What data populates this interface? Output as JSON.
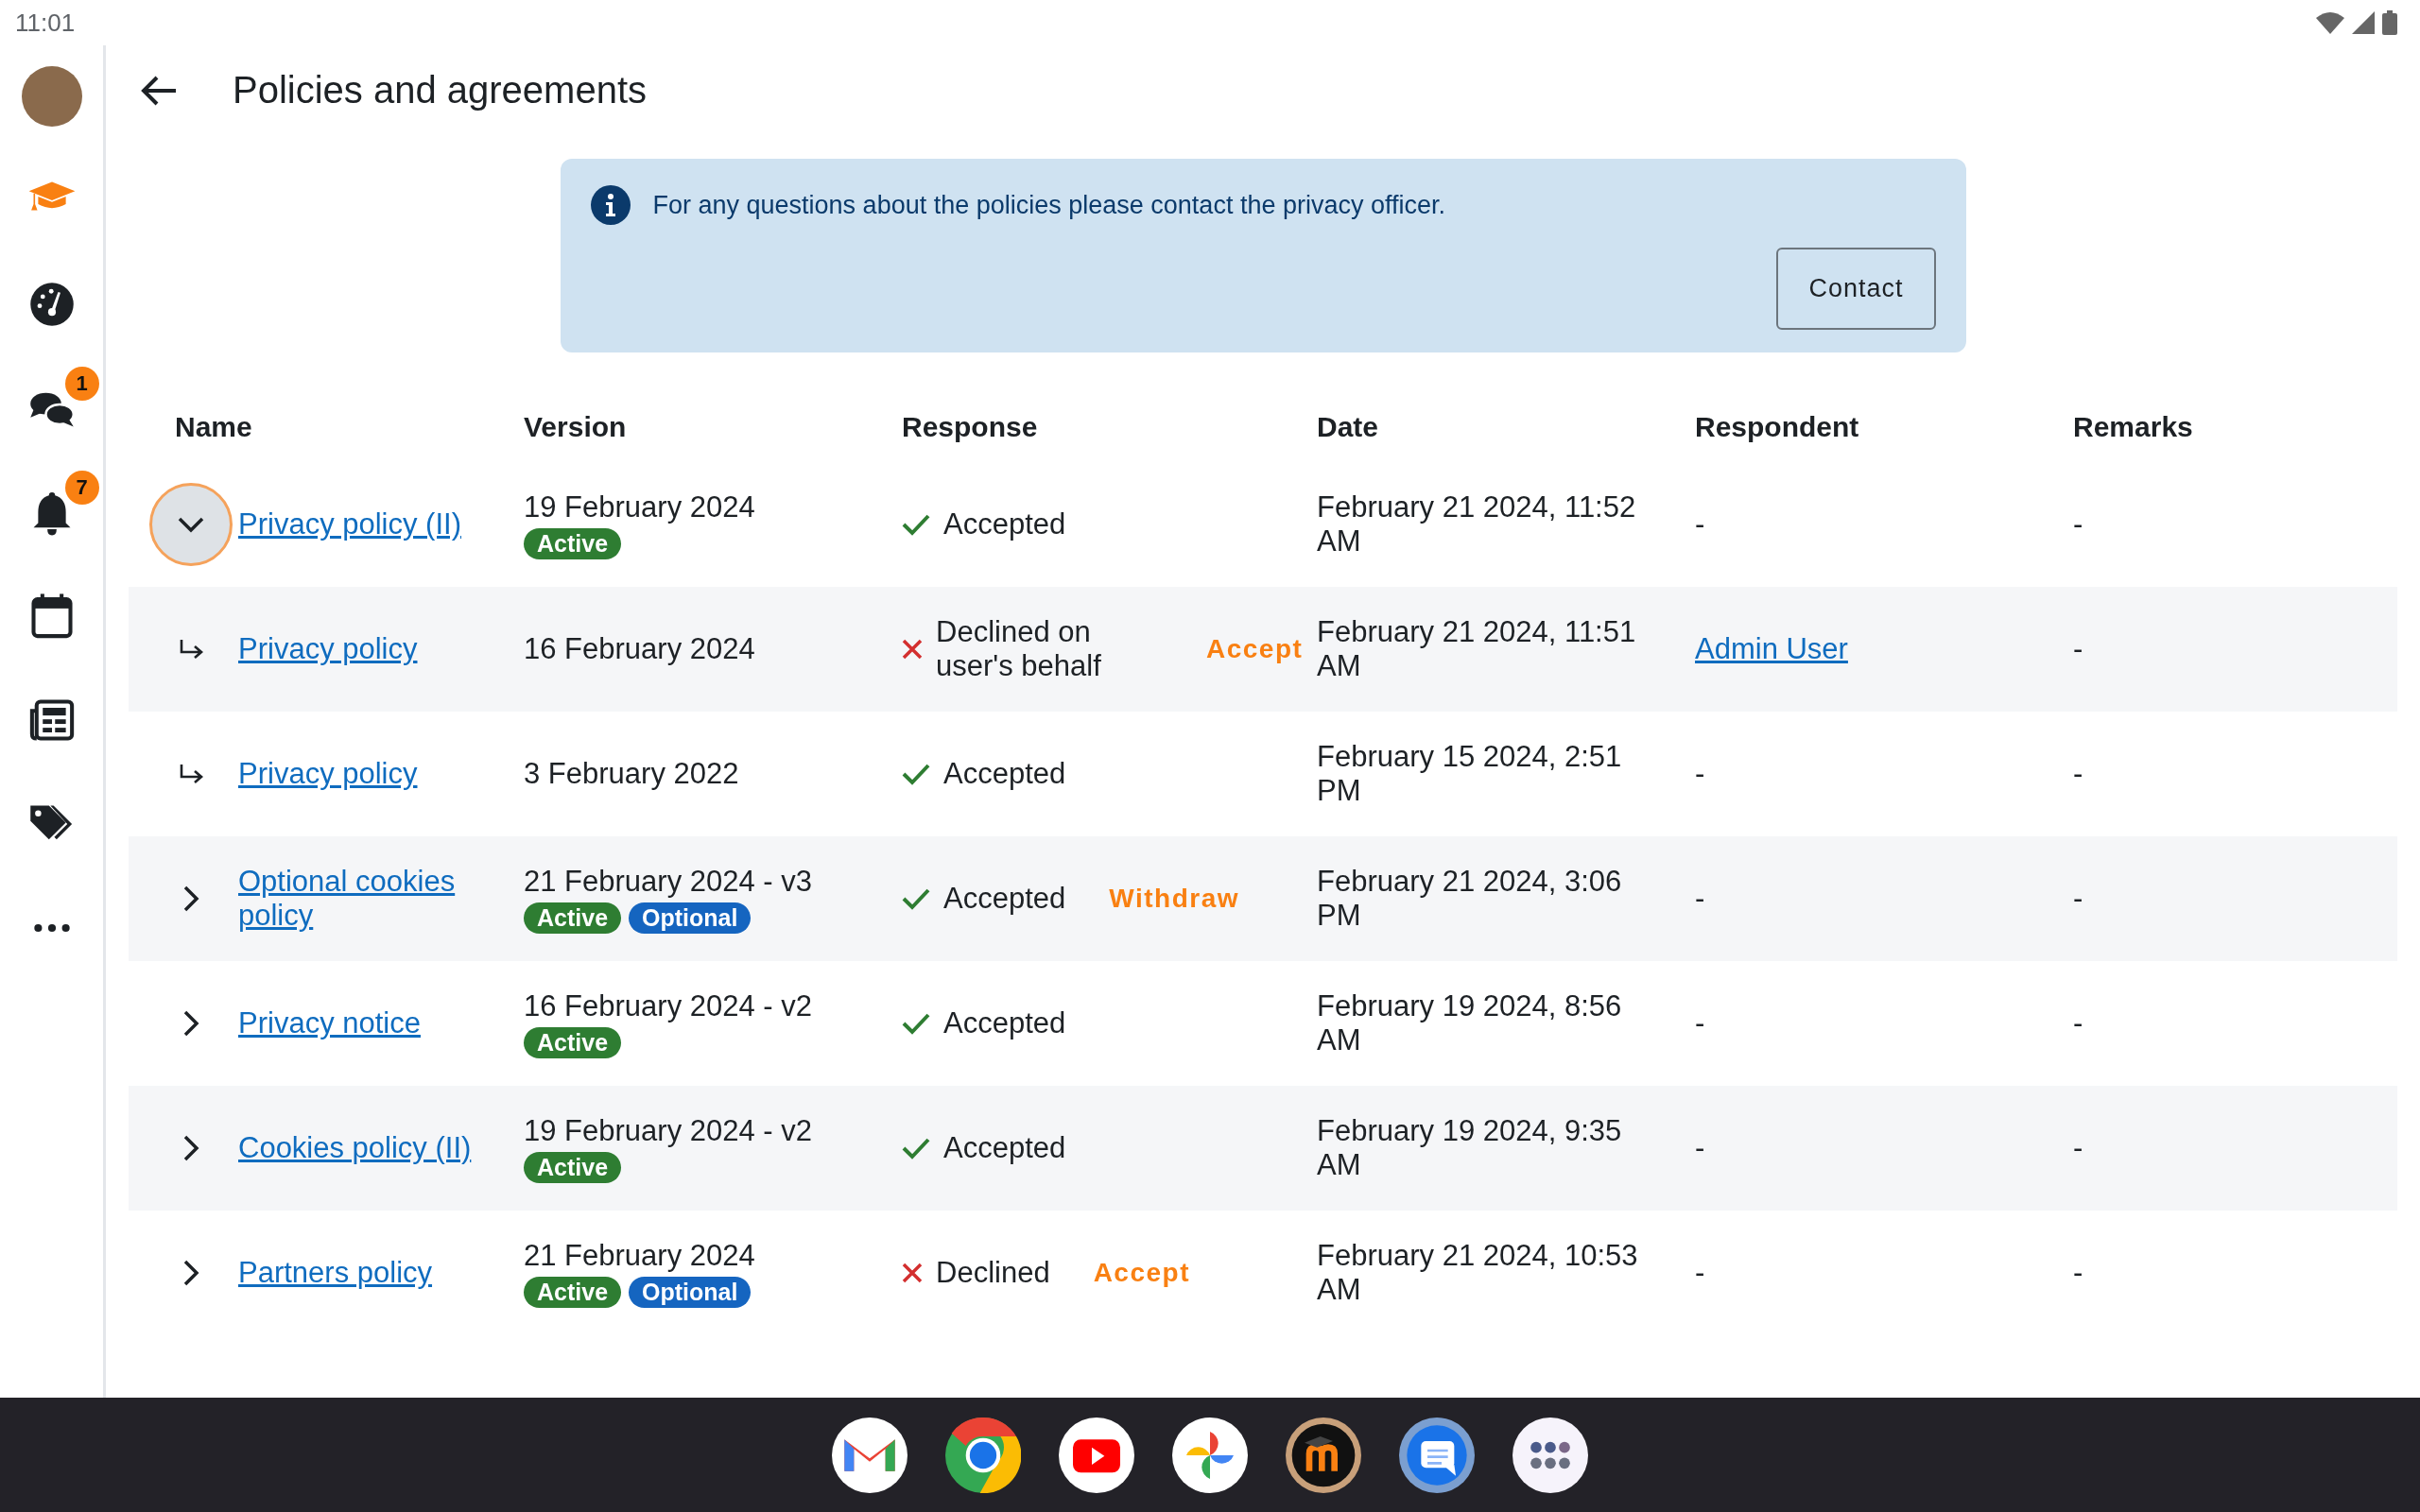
{
  "status_bar": {
    "time": "11:01"
  },
  "sidebar": {
    "items": [
      {
        "selected": false
      },
      {
        "selected": true
      },
      {
        "selected": false
      },
      {
        "selected": false,
        "badge": "1"
      },
      {
        "selected": false,
        "badge": "7"
      },
      {
        "selected": false
      },
      {
        "selected": false
      },
      {
        "selected": false
      },
      {
        "selected": false
      }
    ]
  },
  "header": {
    "title": "Policies and agreements"
  },
  "notice": {
    "text": "For any questions about the policies please contact the privacy officer.",
    "button": "Contact"
  },
  "table": {
    "columns": [
      "Name",
      "Version",
      "Response",
      "Date",
      "Respondent",
      "Remarks"
    ],
    "rows": [
      {
        "kind": "policy",
        "expanded": true,
        "focused": true,
        "name": "Privacy policy (II)",
        "version": "19 February 2024",
        "tags": [
          {
            "label": "Active",
            "color": "#2e7d32"
          }
        ],
        "response": {
          "kind": "accepted",
          "text": "Accepted"
        },
        "date": "February 21 2024, 11:52 AM",
        "respondent": {
          "kind": "text",
          "text": "-"
        },
        "remarks": "-"
      },
      {
        "kind": "version",
        "name": "Privacy policy",
        "version": "16 February 2024",
        "tags": [],
        "response": {
          "kind": "declined",
          "text": "Declined on user's behalf"
        },
        "action": "Accept",
        "date": "February 21 2024, 11:51 AM",
        "respondent": {
          "kind": "link",
          "text": "Admin User"
        },
        "remarks": "-"
      },
      {
        "kind": "version",
        "name": "Privacy policy",
        "version": "3 February 2022",
        "tags": [],
        "response": {
          "kind": "accepted",
          "text": "Accepted"
        },
        "date": "February 15 2024, 2:51 PM",
        "respondent": {
          "kind": "text",
          "text": "-"
        },
        "remarks": "-"
      },
      {
        "kind": "policy",
        "expanded": false,
        "focused": false,
        "name": "Optional cookies policy",
        "version": "21 February 2024 - v3",
        "tags": [
          {
            "label": "Active",
            "color": "#2e7d32"
          },
          {
            "label": "Optional",
            "color": "#1565c0"
          }
        ],
        "response": {
          "kind": "accepted",
          "text": "Accepted"
        },
        "action": "Withdraw",
        "date": "February 21 2024, 3:06 PM",
        "respondent": {
          "kind": "text",
          "text": "-"
        },
        "remarks": "-"
      },
      {
        "kind": "policy",
        "expanded": false,
        "focused": false,
        "name": "Privacy notice",
        "version": "16 February 2024 - v2",
        "tags": [
          {
            "label": "Active",
            "color": "#2e7d32"
          }
        ],
        "response": {
          "kind": "accepted",
          "text": "Accepted"
        },
        "date": "February 19 2024, 8:56 AM",
        "respondent": {
          "kind": "text",
          "text": "-"
        },
        "remarks": "-"
      },
      {
        "kind": "policy",
        "expanded": false,
        "focused": false,
        "name": "Cookies policy (II)",
        "version": "19 February 2024 - v2",
        "tags": [
          {
            "label": "Active",
            "color": "#2e7d32"
          }
        ],
        "response": {
          "kind": "accepted",
          "text": "Accepted"
        },
        "date": "February 19 2024, 9:35 AM",
        "respondent": {
          "kind": "text",
          "text": "-"
        },
        "remarks": "-"
      },
      {
        "kind": "policy",
        "expanded": false,
        "focused": false,
        "name": "Partners policy",
        "version": "21 February 2024",
        "tags": [
          {
            "label": "Active",
            "color": "#2e7d32"
          },
          {
            "label": "Optional",
            "color": "#1565c0"
          }
        ],
        "response": {
          "kind": "declined",
          "text": "Declined"
        },
        "action": "Accept",
        "date": "February 21 2024, 10:53 AM",
        "respondent": {
          "kind": "text",
          "text": "-"
        },
        "remarks": "-"
      }
    ]
  }
}
